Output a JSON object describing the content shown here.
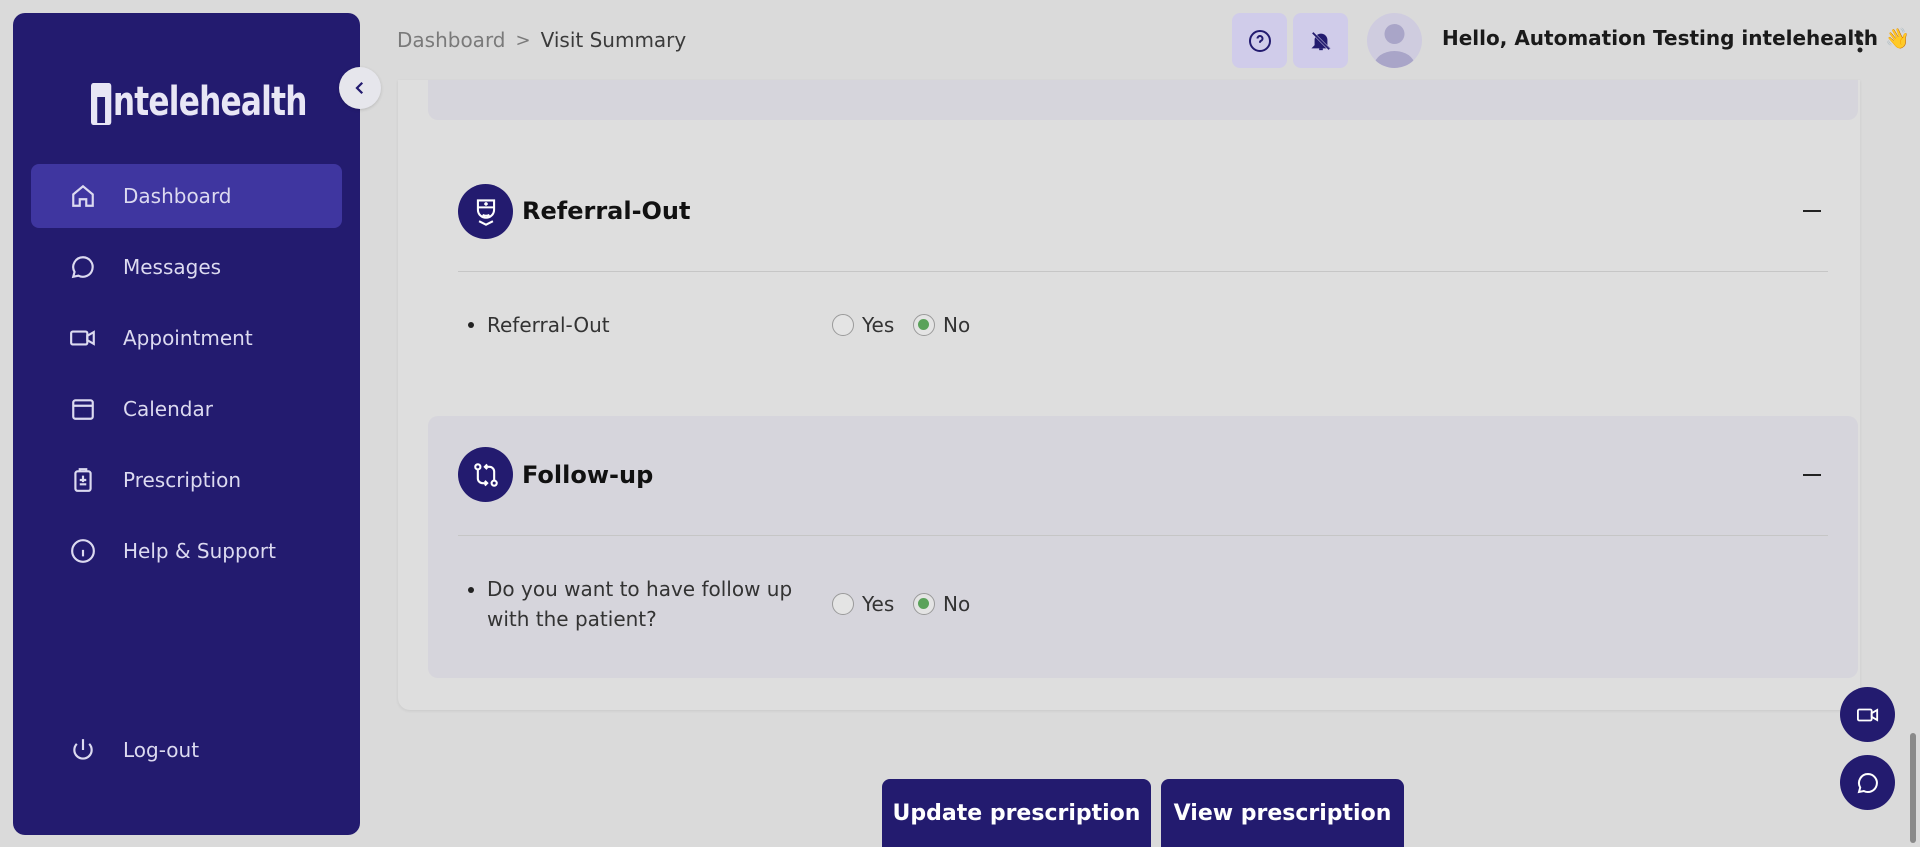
{
  "brand": {
    "name": "ntelehealth"
  },
  "sidebar": {
    "items": [
      {
        "label": "Dashboard",
        "icon": "home-icon",
        "active": true
      },
      {
        "label": "Messages",
        "icon": "chat-icon"
      },
      {
        "label": "Appointment",
        "icon": "video-icon"
      },
      {
        "label": "Calendar",
        "icon": "calendar-icon"
      },
      {
        "label": "Prescription",
        "icon": "clipboard-icon"
      },
      {
        "label": "Help & Support",
        "icon": "info-icon"
      }
    ],
    "logout_label": "Log-out"
  },
  "header": {
    "breadcrumb": {
      "root": "Dashboard",
      "current": "Visit Summary"
    },
    "greeting": "Hello, Automation Testing intelehealth 👋"
  },
  "sections": {
    "referral": {
      "title": "Referral-Out",
      "question": "Referral-Out",
      "options": {
        "yes": "Yes",
        "no": "No"
      },
      "selected": "No"
    },
    "followup": {
      "title": "Follow-up",
      "question_line1": "Do you want to have follow up",
      "question_line2": "with the patient?",
      "options": {
        "yes": "Yes",
        "no": "No"
      },
      "selected": "No"
    }
  },
  "actions": {
    "update_label": "Update prescription",
    "view_label": "View prescription"
  },
  "colors": {
    "primary": "#231b6f",
    "selected_radio": "#5aa25a"
  }
}
